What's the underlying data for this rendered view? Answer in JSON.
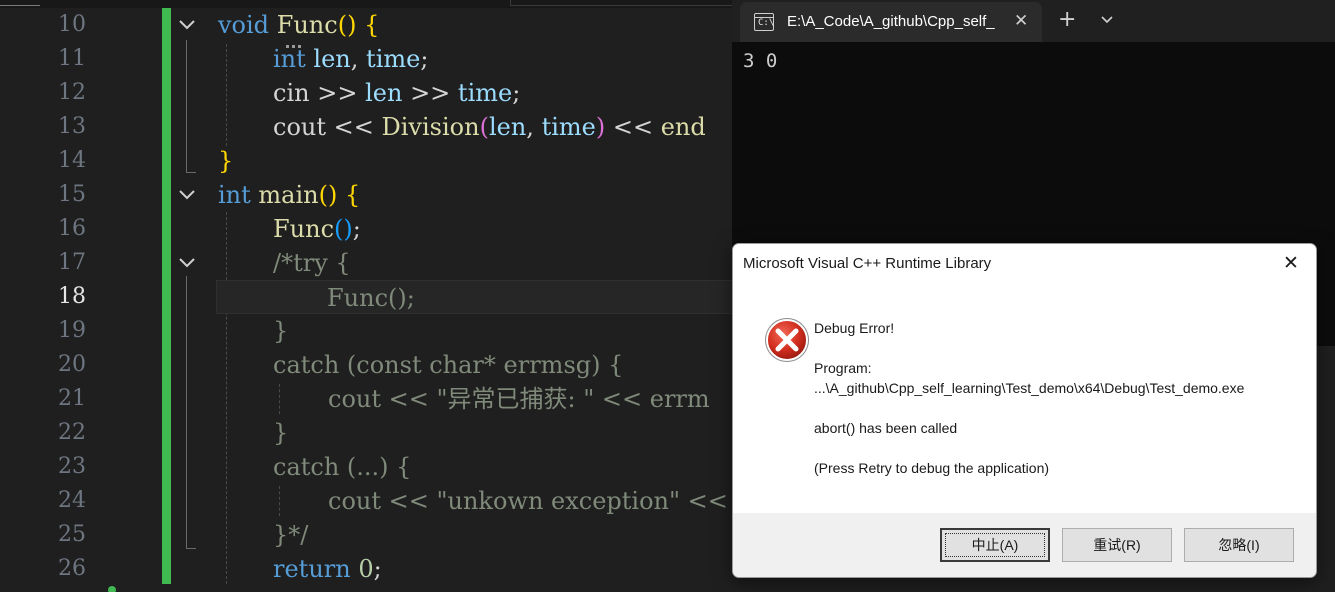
{
  "editor": {
    "line_numbers": [
      "10",
      "11",
      "12",
      "13",
      "14",
      "15",
      "16",
      "17",
      "18",
      "19",
      "20",
      "21",
      "22",
      "23",
      "24",
      "25",
      "26"
    ],
    "active_line": "18",
    "code": {
      "l10": {
        "kw": "void",
        "fn": "Func",
        "parens": "()",
        "brace": "{"
      },
      "l11": {
        "kw": "int",
        "v1": "len",
        "comma": ",",
        "v2": "time",
        "semi": ";"
      },
      "l12": {
        "a": "cin",
        "op1": ">>",
        "b": "len",
        "op2": ">>",
        "c": "time",
        "semi": ";"
      },
      "l13": {
        "a": "cout",
        "op": "<<",
        "fn": "Division",
        "lp": "(",
        "b": "len",
        "comma": ",",
        "c": "time",
        "rp": ")",
        "op2": "<<",
        "d": "end"
      },
      "l14": {
        "brace": "}"
      },
      "l15": {
        "kw": "int",
        "fn": "main",
        "parens": "()",
        "brace": "{"
      },
      "l16": {
        "fn": "Func",
        "parens": "()",
        "semi": ";"
      },
      "l17": "/*try {",
      "l18": "Func();",
      "l19": "}",
      "l20": "catch (const char* errmsg) {",
      "l21": "cout << \"异常已捕获: \" << errm",
      "l22": "}",
      "l23": "catch (...) {",
      "l24": "cout << \"unkown exception\" <<",
      "l25": "}*/",
      "l26": {
        "kw": "return",
        "num": "0",
        "semi": ";"
      }
    }
  },
  "terminal": {
    "tab_title": "E:\\A_Code\\A_github\\Cpp_self_",
    "tab_icon_text": "C:\\",
    "close_glyph": "✕",
    "new_tab_glyph": "+",
    "output": "3 0",
    "icon_names": {
      "tab": "terminal-icon",
      "dropdown": "chevron-down-icon"
    }
  },
  "dialog": {
    "title": "Microsoft Visual C++ Runtime Library",
    "close_glyph": "✕",
    "heading": "Debug Error!",
    "program_label": "Program:",
    "program_path": "...\\A_github\\Cpp_self_learning\\Test_demo\\x64\\Debug\\Test_demo.exe",
    "message": "abort() has been called",
    "hint": "(Press Retry to debug the application)",
    "buttons": {
      "abort": "中止(A)",
      "retry": "重试(R)",
      "ignore": "忽略(I)"
    },
    "icon_name": "error-icon"
  },
  "colors": {
    "keyword": "#569cd6",
    "function": "#dcdcaa",
    "variable": "#9cdcfe",
    "bracket": "#ffd700",
    "comment": "#7f8a7a",
    "change_bar": "#3fb950",
    "error_red": "#c42b1c"
  }
}
